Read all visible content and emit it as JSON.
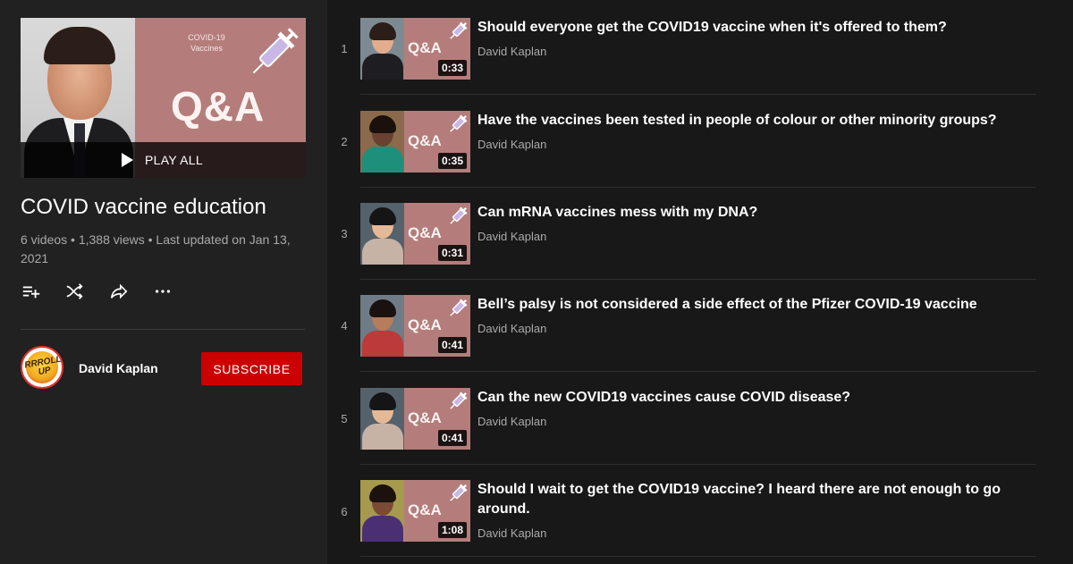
{
  "playlist": {
    "play_all_label": "PLAY ALL",
    "title": "COVID vaccine education",
    "meta": "6 videos • 1,388 views • Last updated on Jan 13, 2021",
    "thumbnail": {
      "card_subtitle_1": "COVID-19",
      "card_subtitle_2": "Vaccines",
      "card_text": "Q&A"
    },
    "actions": [
      {
        "icon": "add-to-queue-icon"
      },
      {
        "icon": "shuffle-icon"
      },
      {
        "icon": "share-icon"
      },
      {
        "icon": "more-icon"
      }
    ]
  },
  "owner": {
    "name": "David Kaplan",
    "subscribe_label": "SUBSCRIBE"
  },
  "videos": [
    {
      "index": "1",
      "title": "Should everyone get the COVID19 vaccine when it's offered to them?",
      "channel": "David Kaplan",
      "duration": "0:33",
      "card_text": "Q&A"
    },
    {
      "index": "2",
      "title": "Have the vaccines been tested in people of colour or other minority groups?",
      "channel": "David Kaplan",
      "duration": "0:35",
      "card_text": "Q&A"
    },
    {
      "index": "3",
      "title": "Can mRNA vaccines mess with my DNA?",
      "channel": "David Kaplan",
      "duration": "0:31",
      "card_text": "Q&A"
    },
    {
      "index": "4",
      "title": "Bell’s palsy is not considered a side effect of the Pfizer COVID-19 vaccine",
      "channel": "David Kaplan",
      "duration": "0:41",
      "card_text": "Q&A"
    },
    {
      "index": "5",
      "title": "Can the new COVID19 vaccines cause COVID disease?",
      "channel": "David Kaplan",
      "duration": "0:41",
      "card_text": "Q&A"
    },
    {
      "index": "6",
      "title": "Should I wait to get the COVID19 vaccine? I heard there are not enough to go around.",
      "channel": "David Kaplan",
      "duration": "1:08",
      "card_text": "Q&A"
    }
  ],
  "colors": {
    "background": "#181818",
    "sidebar": "#212121",
    "subscribe": "#cc0000",
    "card": "#b47d7b",
    "secondary_text": "#aaaaaa"
  }
}
